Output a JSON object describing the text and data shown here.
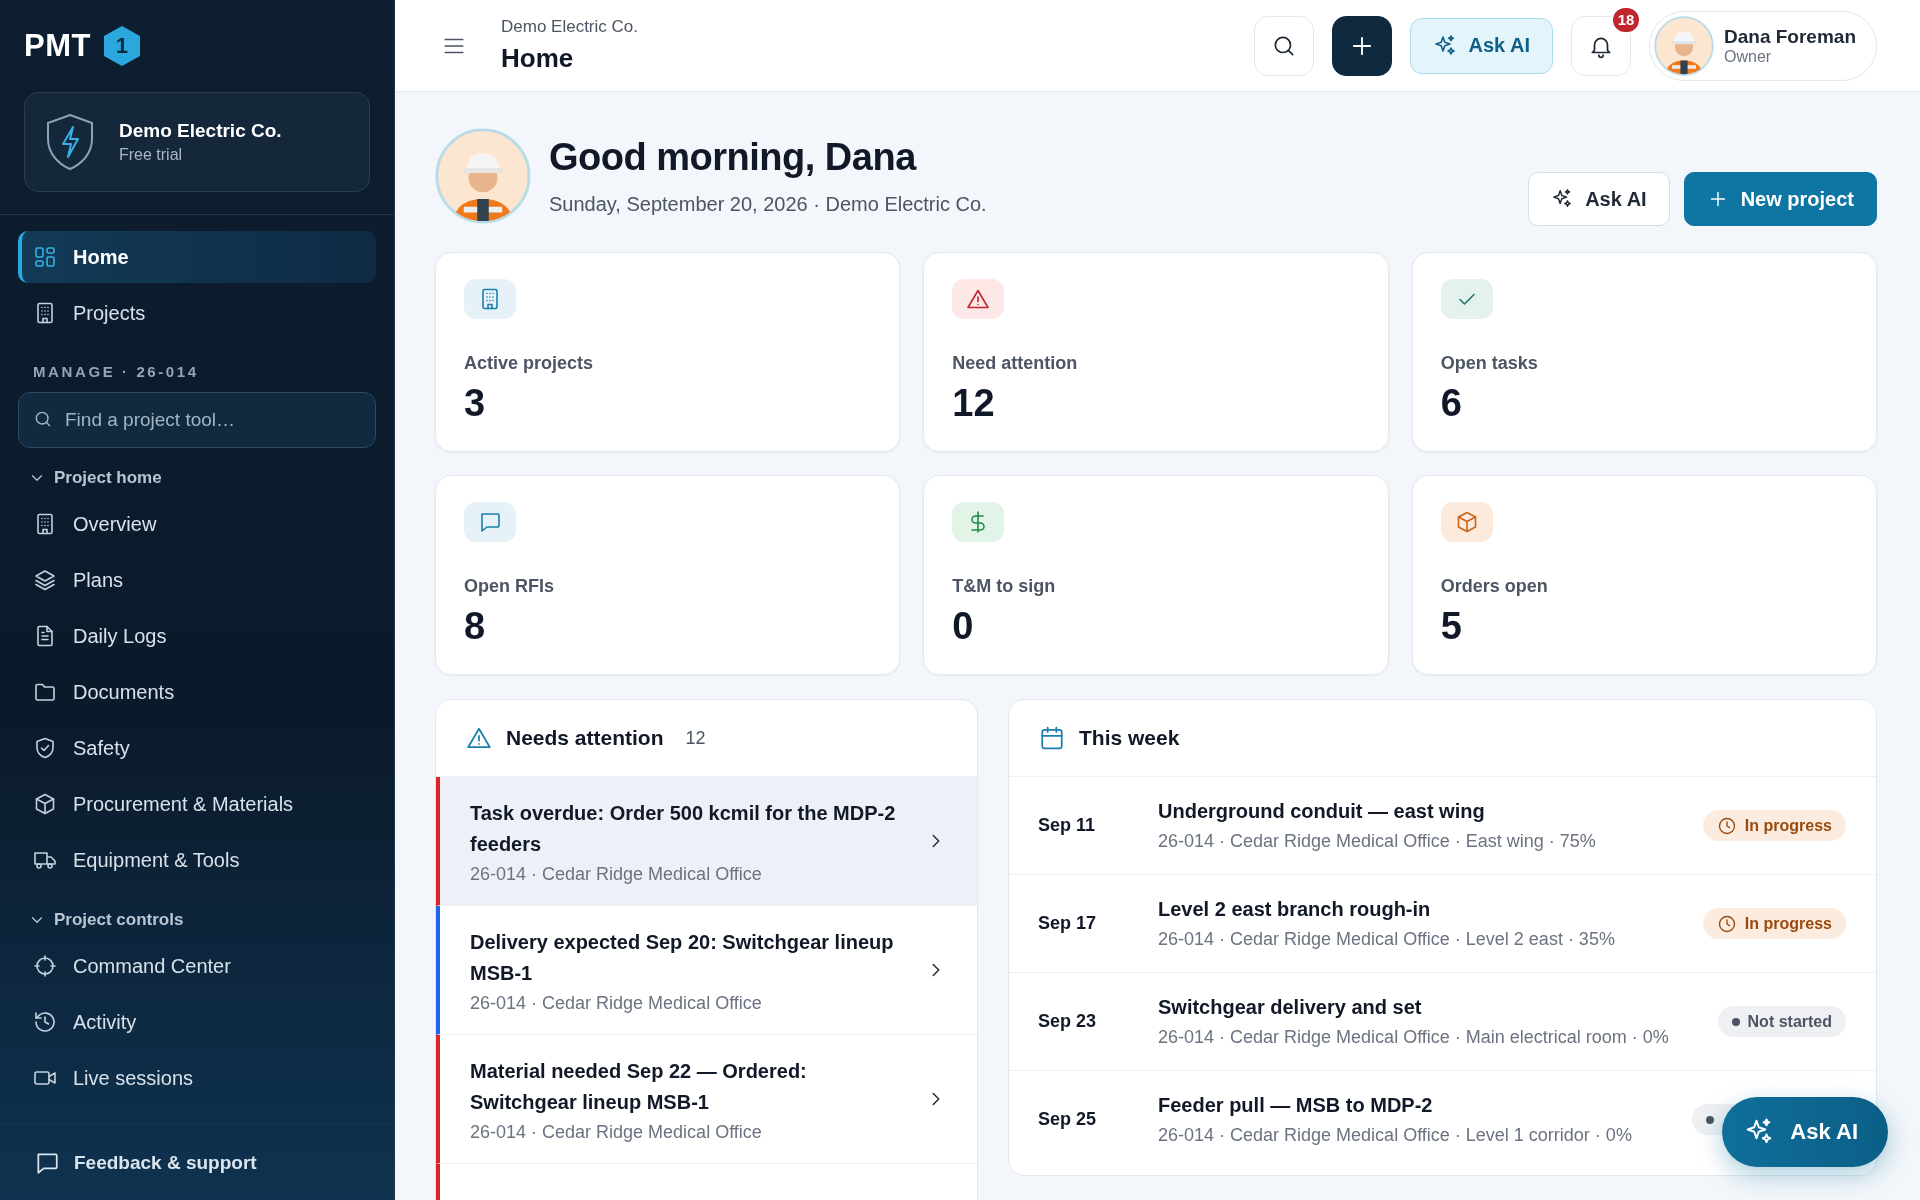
{
  "sidebar": {
    "logo": {
      "text": "PMT",
      "badge": "1"
    },
    "org": {
      "name": "Demo Electric Co.",
      "plan": "Free trial"
    },
    "items": [
      {
        "label": "Home",
        "selected": true
      },
      {
        "label": "Projects",
        "selected": false
      }
    ],
    "section_label": "MANAGE · 26-014",
    "search": {
      "placeholder": "Find a project tool…"
    },
    "groups": [
      {
        "label": "Project home",
        "expanded": true,
        "items": [
          {
            "label": "Overview",
            "selected": false
          },
          {
            "label": "Plans",
            "selected": false
          },
          {
            "label": "Daily Logs",
            "selected": false
          },
          {
            "label": "Documents",
            "selected": false
          },
          {
            "label": "Safety",
            "selected": false
          },
          {
            "label": "Procurement & Materials",
            "selected": false
          },
          {
            "label": "Equipment & Tools",
            "selected": false
          }
        ]
      },
      {
        "label": "Project controls",
        "expanded": true,
        "items": [
          {
            "label": "Command Center",
            "selected": false
          },
          {
            "label": "Activity",
            "selected": false
          },
          {
            "label": "Live sessions",
            "selected": false
          }
        ]
      }
    ],
    "footer": "Feedback & support"
  },
  "header": {
    "breadcrumb": "Demo Electric Co.",
    "title": "Home",
    "ask_ai": "Ask AI",
    "notifications": "18",
    "user": {
      "name": "Dana Foreman",
      "role": "Owner"
    }
  },
  "greeting": {
    "title": "Good morning, Dana",
    "subtitle": "Sunday, September 20, 2026 · Demo Electric Co.",
    "buttons": [
      {
        "label": "Ask AI",
        "kind": "secondary"
      },
      {
        "label": "New project",
        "kind": "primary"
      }
    ]
  },
  "stats": [
    {
      "label": "Active projects",
      "value": "3"
    },
    {
      "label": "Need attention",
      "value": "12"
    },
    {
      "label": "Open tasks",
      "value": "6"
    },
    {
      "label": "Open RFIs",
      "value": "8"
    },
    {
      "label": "T&M to sign",
      "value": "0"
    },
    {
      "label": "Orders open",
      "value": "5"
    }
  ],
  "needs_attention": {
    "title": "Needs attention",
    "count": "12",
    "items": [
      {
        "title": "Task overdue: Order 500 kcmil for the MDP-2 feeders",
        "meta": "26-014 · Cedar Ridge Medical Office",
        "color": "#dc2626",
        "selected": true
      },
      {
        "title": "Delivery expected Sep 20: Switchgear lineup MSB-1",
        "meta": "26-014 · Cedar Ridge Medical Office",
        "color": "#2563eb",
        "selected": false
      },
      {
        "title": "Material needed Sep 22 — Ordered: Switchgear lineup MSB-1",
        "meta": "26-014 · Cedar Ridge Medical Office",
        "color": "#dc2626",
        "selected": false
      }
    ]
  },
  "this_week": {
    "title": "This week",
    "rows": [
      {
        "date": "Sep 11",
        "title": "Underground conduit — east wing",
        "meta": "26-014 · Cedar Ridge Medical Office · East wing · 75%",
        "status": {
          "kind": "in_progress",
          "label": "In progress"
        }
      },
      {
        "date": "Sep 17",
        "title": "Level 2 east branch rough-in",
        "meta": "26-014 · Cedar Ridge Medical Office · Level 2 east · 35%",
        "status": {
          "kind": "in_progress",
          "label": "In progress"
        }
      },
      {
        "date": "Sep 23",
        "title": "Switchgear delivery and set",
        "meta": "26-014 · Cedar Ridge Medical Office · Main electrical room · 0%",
        "status": {
          "kind": "not_started",
          "label": "Not started"
        }
      },
      {
        "date": "Sep 25",
        "title": "Feeder pull — MSB to MDP-2",
        "meta": "26-014 · Cedar Ridge Medical Office · Level 1 corridor · 0%",
        "status": {
          "kind": "not_started"
        }
      }
    ]
  },
  "fab": {
    "label": "Ask AI"
  }
}
